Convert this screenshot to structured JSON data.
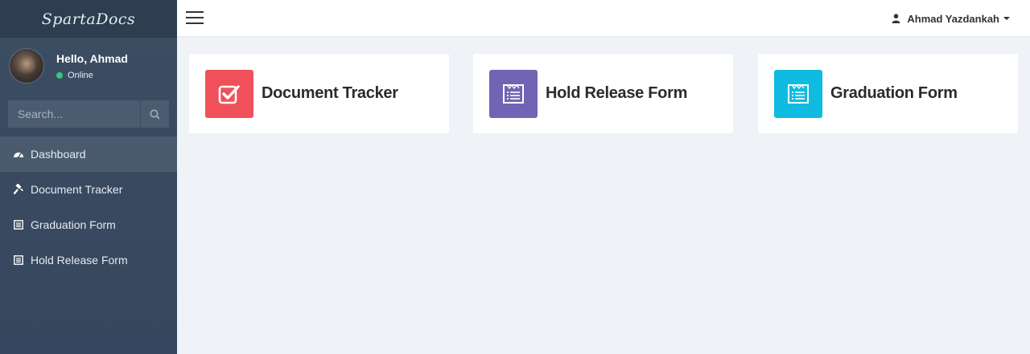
{
  "brand": {
    "name": "SpartaDocs"
  },
  "user_panel": {
    "greeting": "Hello, Ahmad",
    "status": "Online"
  },
  "search": {
    "placeholder": "Search..."
  },
  "nav": [
    {
      "label": "Dashboard",
      "icon": "dashboard-icon",
      "active": true
    },
    {
      "label": "Document Tracker",
      "icon": "gavel-icon",
      "active": false
    },
    {
      "label": "Graduation Form",
      "icon": "form-icon",
      "active": false
    },
    {
      "label": "Hold Release Form",
      "icon": "form-icon",
      "active": false
    }
  ],
  "topbar": {
    "user_name": "Ahmad Yazdankah",
    "user_icon": "user-icon"
  },
  "cards": [
    {
      "title": "Document Tracker",
      "icon": "checkbox-icon",
      "color": "#f0505a"
    },
    {
      "title": "Hold Release Form",
      "icon": "form-icon",
      "color": "#7264b4"
    },
    {
      "title": "Graduation Form",
      "icon": "form-icon",
      "color": "#0fbbe0"
    }
  ],
  "colors": {
    "sidebar": "#3c4e63",
    "content_bg": "#eff2f6",
    "status_online": "#3cc47c"
  }
}
